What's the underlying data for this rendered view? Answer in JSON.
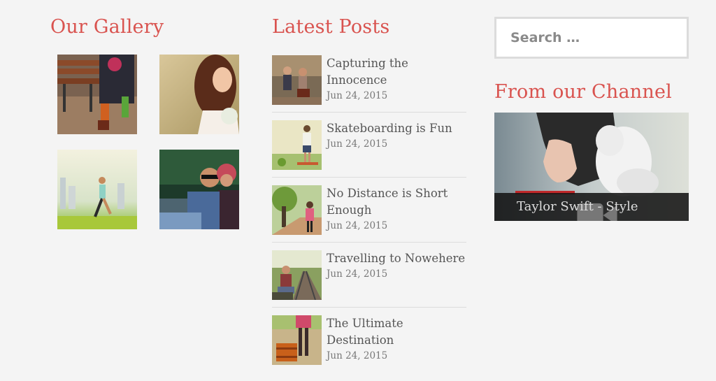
{
  "gallery": {
    "title": "Our Gallery",
    "images": [
      {
        "name": "gallery-photo-couple-bench"
      },
      {
        "name": "gallery-photo-bride-flowers"
      },
      {
        "name": "gallery-photo-runner"
      },
      {
        "name": "gallery-photo-couple-sunglasses"
      }
    ]
  },
  "posts": {
    "title": "Latest Posts",
    "items": [
      {
        "title": "Capturing the Innocence",
        "date": "Jun 24, 2015"
      },
      {
        "title": "Skateboarding is Fun",
        "date": "Jun 24, 2015"
      },
      {
        "title": "No Distance is Short Enough",
        "date": "Jun 24, 2015"
      },
      {
        "title": "Travelling to Nowehere",
        "date": "Jun 24, 2015"
      },
      {
        "title": "The Ultimate Destination",
        "date": "Jun 24, 2015"
      }
    ]
  },
  "sidebar": {
    "search_placeholder": "Search …",
    "channel_title": "From our Channel",
    "video_title": "Taylor Swift - Style",
    "video_icon": "video-camera-icon"
  },
  "colors": {
    "accent": "#d9534f",
    "background": "#f4f4f4",
    "text": "#555555",
    "date": "#777777"
  }
}
